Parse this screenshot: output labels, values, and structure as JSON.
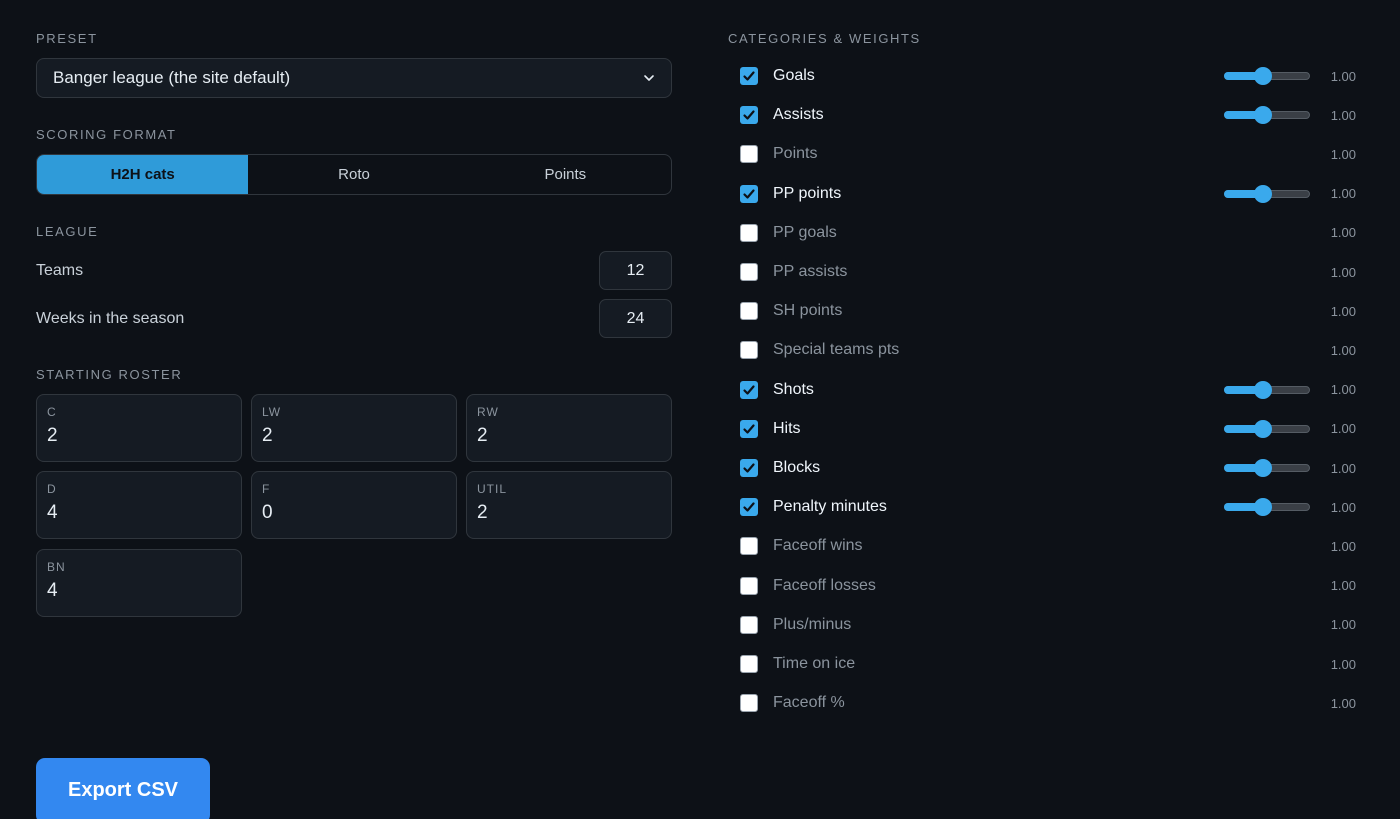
{
  "preset": {
    "label": "PRESET",
    "selected": "Banger league (the site default)"
  },
  "scoring": {
    "label": "SCORING FORMAT",
    "options": [
      "H2H cats",
      "Roto",
      "Points"
    ],
    "selected": "H2H cats"
  },
  "league": {
    "label": "LEAGUE",
    "teams_label": "Teams",
    "teams_value": "12",
    "weeks_label": "Weeks in the season",
    "weeks_value": "24"
  },
  "roster": {
    "label": "STARTING ROSTER",
    "slots": [
      {
        "pos": "C",
        "count": "2"
      },
      {
        "pos": "LW",
        "count": "2"
      },
      {
        "pos": "RW",
        "count": "2"
      },
      {
        "pos": "D",
        "count": "4"
      },
      {
        "pos": "F",
        "count": "0"
      },
      {
        "pos": "UTIL",
        "count": "2"
      },
      {
        "pos": "BN",
        "count": "4"
      }
    ]
  },
  "export_label": "Export CSV",
  "categories": {
    "label": "CATEGORIES & WEIGHTS",
    "slider_level": 0.45,
    "items": [
      {
        "name": "Goals",
        "checked": true,
        "weight": "1.00"
      },
      {
        "name": "Assists",
        "checked": true,
        "weight": "1.00"
      },
      {
        "name": "Points",
        "checked": false,
        "weight": "1.00"
      },
      {
        "name": "PP points",
        "checked": true,
        "weight": "1.00"
      },
      {
        "name": "PP goals",
        "checked": false,
        "weight": "1.00"
      },
      {
        "name": "PP assists",
        "checked": false,
        "weight": "1.00"
      },
      {
        "name": "SH points",
        "checked": false,
        "weight": "1.00"
      },
      {
        "name": "Special teams pts",
        "checked": false,
        "weight": "1.00"
      },
      {
        "name": "Shots",
        "checked": true,
        "weight": "1.00"
      },
      {
        "name": "Hits",
        "checked": true,
        "weight": "1.00"
      },
      {
        "name": "Blocks",
        "checked": true,
        "weight": "1.00"
      },
      {
        "name": "Penalty minutes",
        "checked": true,
        "weight": "1.00"
      },
      {
        "name": "Faceoff wins",
        "checked": false,
        "weight": "1.00"
      },
      {
        "name": "Faceoff losses",
        "checked": false,
        "weight": "1.00"
      },
      {
        "name": "Plus/minus",
        "checked": false,
        "weight": "1.00"
      },
      {
        "name": "Time on ice",
        "checked": false,
        "weight": "1.00"
      },
      {
        "name": "Faceoff %",
        "checked": false,
        "weight": "1.00"
      }
    ]
  },
  "colors": {
    "background": "#0d1117",
    "accent": "#3aa9ec",
    "segment_active": "#2f9bd9",
    "button": "#3388f0"
  }
}
